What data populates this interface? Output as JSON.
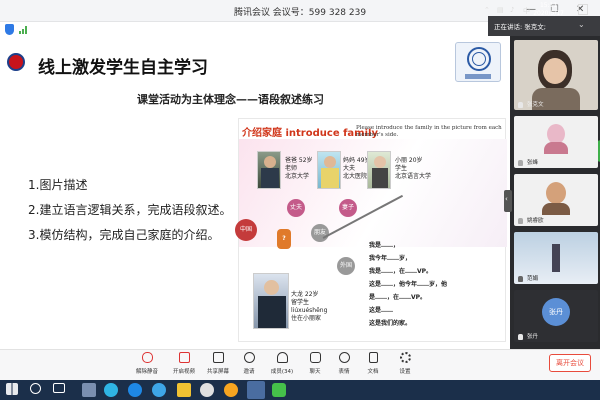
{
  "window": {
    "title": "腾讯会议 会议号：599 328 239"
  },
  "speaking": {
    "label": "正在讲话: 张克文;"
  },
  "slide": {
    "title": "线上激发学生自主学习",
    "subtitle": "课堂活动为主体理念——语段叙述练习",
    "bullets": [
      "1.图片描述",
      "2.建立语言逻辑关系，完成语段叙述。",
      "3.模仿结构，完成自己家庭的介绍。"
    ],
    "panel": {
      "heading": "介绍家庭 introduce  family",
      "instruction": "Please introduce the family in the picture from each member's side.",
      "father": [
        "爸爸 52岁",
        "老师",
        "北京大学"
      ],
      "mother": [
        "妈妈 49岁",
        "大夫",
        "北大医院"
      ],
      "younger": [
        "小丽  20岁",
        "学生",
        "北京语言大学"
      ],
      "elder": [
        "大龙 22岁",
        "留学生",
        "liúxuéshēng",
        "住在小丽家"
      ],
      "bubbles": {
        "husband": "丈夫",
        "wife": "妻子",
        "daughter": "女儿",
        "china": "中国",
        "friend": "朋友",
        "foreign": "外国"
      },
      "question": "?",
      "script": [
        "我是……，",
        "我今年……岁，",
        "我是……，在……VP。",
        "这是……，他今年……岁，他",
        "是……，在……VP。",
        "这是……",
        "这是我们的家。"
      ]
    }
  },
  "participants": [
    {
      "name": "张克文",
      "color": "#7a6b5d"
    },
    {
      "name": "张峰",
      "color": "#e9b8c8"
    },
    {
      "name": "姚睿欧",
      "color": "#d4a17a"
    },
    {
      "name": "范娟",
      "color": "#8fb0cf"
    },
    {
      "name": "张丹",
      "initials": "张丹",
      "color": "#5b8fd6"
    }
  ],
  "toolbar": {
    "items": [
      "解除静音",
      "开启视频",
      "共享屏幕",
      "邀请",
      "成员(34)",
      "聊天",
      "表情",
      "文档",
      "设置"
    ],
    "leave": "离开会议"
  },
  "taskbar": {
    "time": "15:11",
    "date": "2020/5/17"
  }
}
